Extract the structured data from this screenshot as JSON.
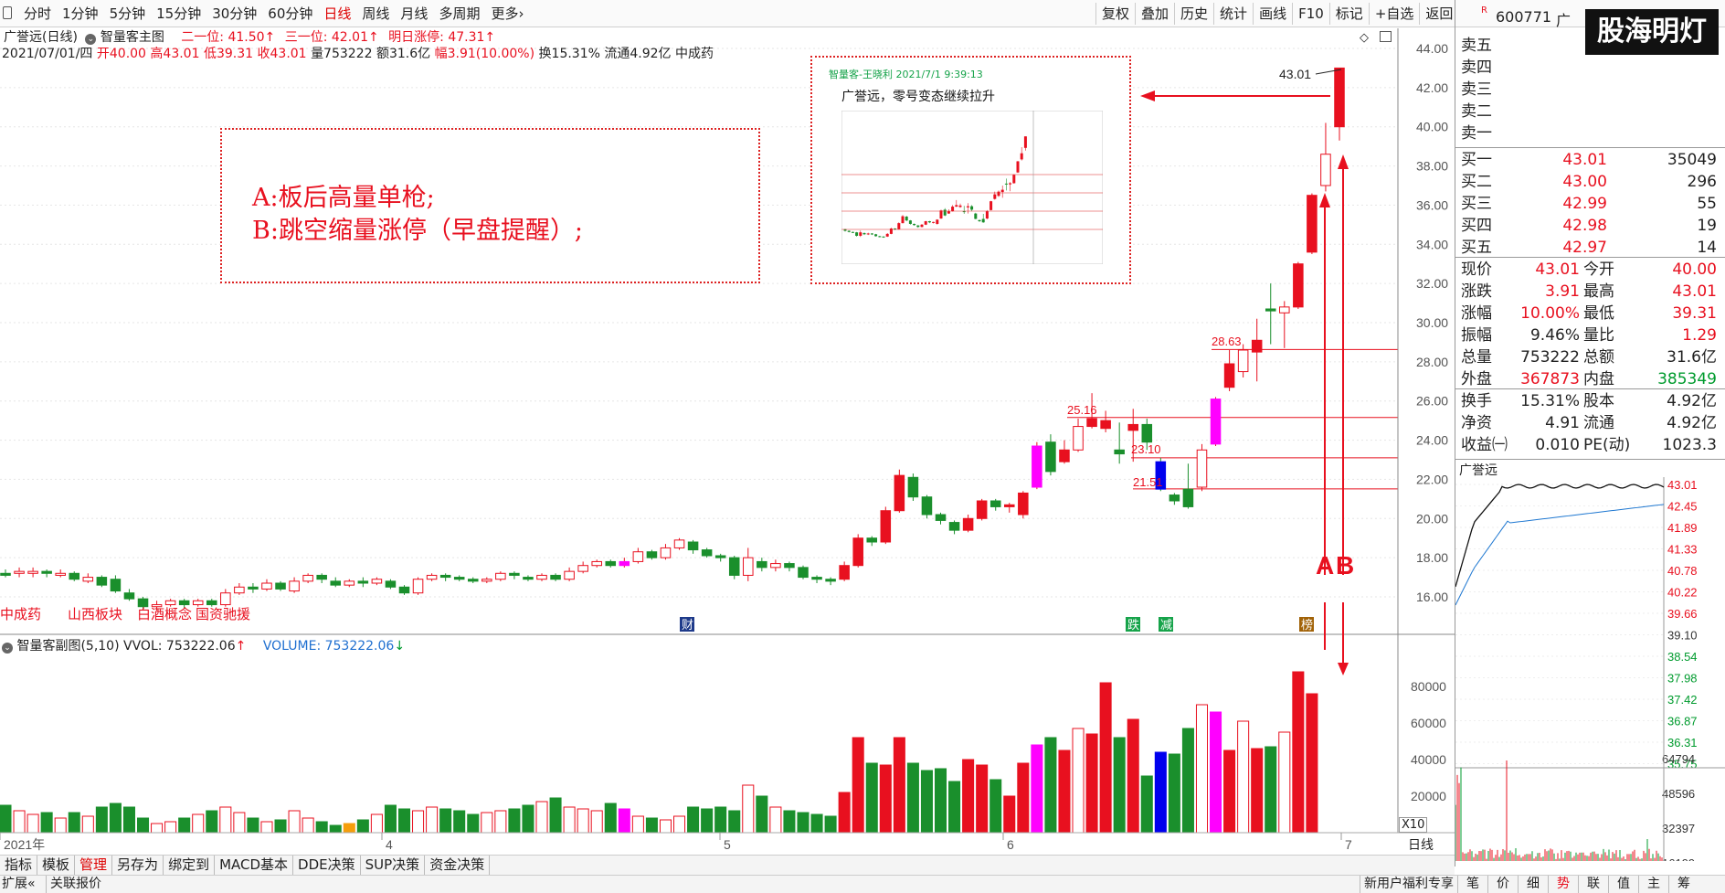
{
  "toolbar": {
    "periods": [
      "分时",
      "1分钟",
      "5分钟",
      "15分钟",
      "30分钟",
      "60分钟",
      "日线",
      "周线",
      "月线",
      "多周期",
      "更多"
    ],
    "active_period": "日线",
    "tools": [
      "复权",
      "叠加",
      "历史",
      "统计",
      "画线",
      "F10",
      "标记",
      "+自选",
      "返回"
    ]
  },
  "chart_header": {
    "title": "广誉远(日线)",
    "indicator": "智量客主图",
    "level2": "二一位: 41.50",
    "level3": "三一位: 42.01",
    "limit_up": "明日涨停: 47.31",
    "date": "2021/07/01/四",
    "open": "开40.00",
    "high": "高43.01",
    "low": "低39.31",
    "close": "收43.01",
    "vol": "量753222",
    "amount": "额31.6亿",
    "change": "幅3.91(10.00%)",
    "turnover": "换15.31%",
    "float": "流通4.92亿",
    "industry": "中成药"
  },
  "annotation": {
    "line_a": "A:板后高量单枪;",
    "line_b": "B:跳空缩量涨停（早盘提醒）;",
    "inset_header": "智量客-王晓利 2021/7/1 9:39:13",
    "inset_title": "广誉远，零号变态继续拉升",
    "price_43": "43.01",
    "marker_a": "A",
    "marker_b": "B",
    "lvl_2863": "28.63",
    "lvl_2516": "25.16",
    "lvl_2310": "23.10",
    "lvl_2151": "21.51"
  },
  "concept_tags": [
    "中成药",
    "山西板块",
    "白酒概念",
    "国资驰援"
  ],
  "event_marks": [
    "财",
    "跌",
    "减",
    "榜"
  ],
  "volume_header": {
    "name": "智量客副图(5,10)",
    "vvol": "VVOL: 753222.06",
    "volume": "VOLUME: 753222.06"
  },
  "price_axis": [
    "44.00",
    "42.00",
    "40.00",
    "38.00",
    "36.00",
    "34.00",
    "32.00",
    "30.00",
    "28.00",
    "26.00",
    "24.00",
    "22.00",
    "20.00",
    "18.00",
    "16.00"
  ],
  "vol_axis": [
    "80000",
    "60000",
    "40000",
    "20000"
  ],
  "vol_unit": "X10",
  "time_axis": [
    "2021年",
    "4",
    "5",
    "6",
    "7"
  ],
  "bottom_tabs": [
    "指标",
    "模板",
    "管理",
    "另存为",
    "绑定到",
    "MACD基本",
    "DDE决策",
    "SUP决策",
    "资金决策"
  ],
  "status": {
    "left": [
      "扩展",
      "关联报价"
    ],
    "right": [
      "新用户福利专享",
      "笔",
      "价",
      "细",
      "势",
      "联",
      "值",
      "主",
      "筹"
    ]
  },
  "right": {
    "code": "600771",
    "name_short": "广",
    "logo": "股海明灯",
    "sells": [
      [
        "卖五",
        "",
        ""
      ],
      [
        "卖四",
        "",
        ""
      ],
      [
        "卖三",
        "",
        ""
      ],
      [
        "卖二",
        "",
        ""
      ],
      [
        "卖一",
        "",
        ""
      ]
    ],
    "buys": [
      [
        "买一",
        "43.01",
        "35049"
      ],
      [
        "买二",
        "43.00",
        "296"
      ],
      [
        "买三",
        "42.99",
        "55"
      ],
      [
        "买四",
        "42.98",
        "19"
      ],
      [
        "买五",
        "42.97",
        "14"
      ]
    ],
    "stats": [
      [
        "现价",
        "43.01",
        "今开",
        "40.00"
      ],
      [
        "涨跌",
        "3.91",
        "最高",
        "43.01"
      ],
      [
        "涨幅",
        "10.00%",
        "最低",
        "39.31"
      ],
      [
        "振幅",
        "9.46%",
        "量比",
        "1.29"
      ],
      [
        "总量",
        "753222",
        "总额",
        "31.6亿"
      ],
      [
        "外盘",
        "367873",
        "内盘",
        "385349"
      ]
    ],
    "stats2": [
      [
        "换手",
        "15.31%",
        "股本",
        "4.92亿"
      ],
      [
        "净资",
        "4.91",
        "流通",
        "4.92亿"
      ],
      [
        "收益㈠",
        "0.010",
        "PE(动)",
        "1023.3"
      ]
    ],
    "mini_title": "广誉远",
    "mini_prices": [
      "43.01",
      "42.45",
      "41.89",
      "41.33",
      "40.78",
      "40.22",
      "39.66",
      "39.10",
      "38.54",
      "37.98",
      "37.42",
      "36.87",
      "36.31",
      "35.75"
    ],
    "mini_vols": [
      "64794",
      "48596",
      "32397",
      "16199"
    ],
    "tab": "日线"
  },
  "chart_data": {
    "type": "candlestick",
    "ylim": [
      15,
      45
    ],
    "candles": [
      [
        17.2,
        17.1,
        17.0,
        17.4
      ],
      [
        17.2,
        17.3,
        17.0,
        17.5
      ],
      [
        17.2,
        17.3,
        17.0,
        17.5
      ],
      [
        17.3,
        17.2,
        17.0,
        17.4
      ],
      [
        17.1,
        17.2,
        17.0,
        17.4
      ],
      [
        17.2,
        16.9,
        16.8,
        17.3
      ],
      [
        16.8,
        17.0,
        16.7,
        17.2
      ],
      [
        17.0,
        16.6,
        16.5,
        17.1
      ],
      [
        16.9,
        16.3,
        16.2,
        17.1
      ],
      [
        16.2,
        15.9,
        15.8,
        16.4
      ],
      [
        15.9,
        15.5,
        15.4,
        16.0
      ],
      [
        15.5,
        15.6,
        15.3,
        15.8
      ],
      [
        15.6,
        15.8,
        15.5,
        15.9
      ],
      [
        15.8,
        15.6,
        15.4,
        15.9
      ],
      [
        15.6,
        15.8,
        15.5,
        15.9
      ],
      [
        15.8,
        15.6,
        15.5,
        15.9
      ],
      [
        15.6,
        16.2,
        15.5,
        16.4
      ],
      [
        16.2,
        16.5,
        16.1,
        16.7
      ],
      [
        16.5,
        16.4,
        16.2,
        16.7
      ],
      [
        16.4,
        16.7,
        16.3,
        16.9
      ],
      [
        16.7,
        16.4,
        16.3,
        16.8
      ],
      [
        16.3,
        16.8,
        16.2,
        17.0
      ],
      [
        16.8,
        17.1,
        16.7,
        17.2
      ],
      [
        17.1,
        16.9,
        16.7,
        17.2
      ],
      [
        16.8,
        16.6,
        16.5,
        17.0
      ],
      [
        16.6,
        16.8,
        16.5,
        16.9
      ],
      [
        16.8,
        16.7,
        16.5,
        17.0
      ],
      [
        16.7,
        16.9,
        16.6,
        17.0
      ],
      [
        16.8,
        16.5,
        16.4,
        16.9
      ],
      [
        16.5,
        16.2,
        16.1,
        16.6
      ],
      [
        16.2,
        16.9,
        16.1,
        17.0
      ],
      [
        16.9,
        17.1,
        16.8,
        17.2
      ],
      [
        17.1,
        17.0,
        16.8,
        17.2
      ],
      [
        17.0,
        16.9,
        16.8,
        17.1
      ],
      [
        16.9,
        16.8,
        16.7,
        17.0
      ],
      [
        16.8,
        16.9,
        16.7,
        17.0
      ],
      [
        16.9,
        17.2,
        16.8,
        17.3
      ],
      [
        17.2,
        17.1,
        16.9,
        17.3
      ],
      [
        17.0,
        16.9,
        16.8,
        17.1
      ],
      [
        16.9,
        17.1,
        16.8,
        17.2
      ],
      [
        17.1,
        16.9,
        16.8,
        17.2
      ],
      [
        16.9,
        17.3,
        16.8,
        17.5
      ],
      [
        17.3,
        17.6,
        17.2,
        17.8
      ],
      [
        17.6,
        17.8,
        17.5,
        17.9
      ],
      [
        17.8,
        17.6,
        17.5,
        17.9
      ],
      [
        17.6,
        17.8,
        17.5,
        18.0
      ],
      [
        17.8,
        18.3,
        17.7,
        18.5
      ],
      [
        18.3,
        18.0,
        17.9,
        18.4
      ],
      [
        18.0,
        18.5,
        17.9,
        18.7
      ],
      [
        18.5,
        18.9,
        18.4,
        19.0
      ],
      [
        18.8,
        18.4,
        18.2,
        18.9
      ],
      [
        18.4,
        18.1,
        18.0,
        18.5
      ],
      [
        18.1,
        18.0,
        17.8,
        18.2
      ],
      [
        18.0,
        17.1,
        16.9,
        18.1
      ],
      [
        17.1,
        18.0,
        16.8,
        18.5
      ],
      [
        17.8,
        17.5,
        17.3,
        18.0
      ],
      [
        17.5,
        17.7,
        17.3,
        17.9
      ],
      [
        17.7,
        17.5,
        17.3,
        17.8
      ],
      [
        17.5,
        17.0,
        16.9,
        17.6
      ],
      [
        17.0,
        16.9,
        16.7,
        17.1
      ],
      [
        16.9,
        16.8,
        16.6,
        17.0
      ],
      [
        16.9,
        17.6,
        16.8,
        17.8
      ],
      [
        17.6,
        19.0,
        17.5,
        19.2
      ],
      [
        19.0,
        18.8,
        18.6,
        19.1
      ],
      [
        18.8,
        20.4,
        18.7,
        20.6
      ],
      [
        20.4,
        22.2,
        20.3,
        22.5
      ],
      [
        22.1,
        21.1,
        20.9,
        22.3
      ],
      [
        21.1,
        20.2,
        20.0,
        21.2
      ],
      [
        20.2,
        19.9,
        19.7,
        20.3
      ],
      [
        19.8,
        19.4,
        19.2,
        19.9
      ],
      [
        19.4,
        20.0,
        19.3,
        20.2
      ],
      [
        20.0,
        20.9,
        19.9,
        21.0
      ],
      [
        20.9,
        20.6,
        20.4,
        21.0
      ],
      [
        20.6,
        20.7,
        20.3,
        20.8
      ],
      [
        20.2,
        21.3,
        20.0,
        21.4
      ],
      [
        21.6,
        23.7,
        21.5,
        23.9
      ],
      [
        23.9,
        22.4,
        22.2,
        24.3
      ],
      [
        22.9,
        23.5,
        22.8,
        24.0
      ],
      [
        23.5,
        24.7,
        23.4,
        25.1
      ],
      [
        24.7,
        25.1,
        24.6,
        26.4
      ],
      [
        24.6,
        25.0,
        24.4,
        25.5
      ],
      [
        23.5,
        23.3,
        22.8,
        24.9
      ],
      [
        24.5,
        24.8,
        22.9,
        25.6
      ],
      [
        24.8,
        23.9,
        23.5,
        25.1
      ],
      [
        22.9,
        21.5,
        21.4,
        23.1
      ],
      [
        21.2,
        20.9,
        20.7,
        21.3
      ],
      [
        21.5,
        20.6,
        20.5,
        22.8
      ],
      [
        21.6,
        23.5,
        21.4,
        23.8
      ],
      [
        23.8,
        26.1,
        23.7,
        26.2
      ],
      [
        26.7,
        27.9,
        26.5,
        28.6
      ],
      [
        27.5,
        28.6,
        27.2,
        28.9
      ],
      [
        28.5,
        29.1,
        27.0,
        30.2
      ],
      [
        30.7,
        30.6,
        28.9,
        32.0
      ],
      [
        30.5,
        30.8,
        28.7,
        31.1
      ],
      [
        30.8,
        33.0,
        30.7,
        33.1
      ],
      [
        33.6,
        36.5,
        33.5,
        36.6
      ],
      [
        37.0,
        38.6,
        36.7,
        40.2
      ],
      [
        40.0,
        43.0,
        39.3,
        43.0
      ]
    ],
    "volumes": [
      15000,
      12000,
      10000,
      11000,
      8000,
      11000,
      9000,
      14000,
      16000,
      14000,
      8000,
      5000,
      6000,
      8000,
      10000,
      12000,
      14000,
      11000,
      8000,
      6000,
      7000,
      12000,
      8000,
      6000,
      4000,
      5000,
      7000,
      10000,
      15000,
      13000,
      12000,
      14000,
      13000,
      12000,
      10000,
      11000,
      12000,
      13000,
      15000,
      17000,
      19000,
      14000,
      13000,
      12000,
      16000,
      13000,
      9000,
      8000,
      7000,
      9000,
      14000,
      13000,
      14000,
      12000,
      26000,
      20000,
      14000,
      12000,
      11000,
      10000,
      9000,
      22000,
      52000,
      38000,
      37000,
      52000,
      38000,
      34000,
      35000,
      28000,
      40000,
      37000,
      29000,
      20000,
      38000,
      48000,
      52000,
      45000,
      57000,
      54000,
      82000,
      52000,
      62000,
      31000,
      44000,
      43000,
      57000,
      70000,
      66000,
      45000,
      61000,
      46000,
      47000,
      55000,
      88000,
      76000
    ]
  }
}
